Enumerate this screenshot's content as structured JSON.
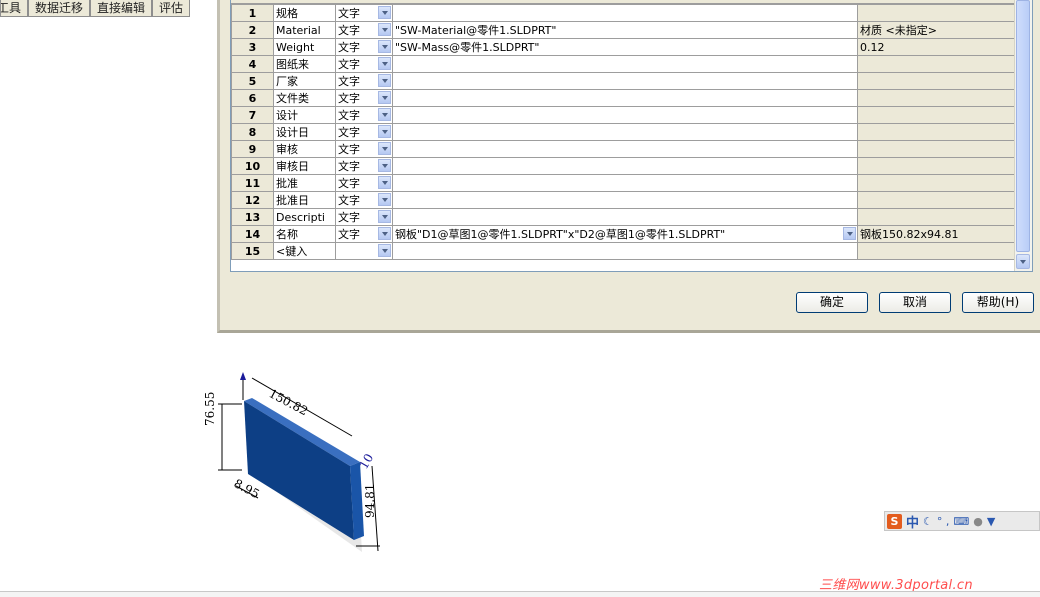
{
  "command_tabs": [
    "工具",
    "数据迁移",
    "直接编辑",
    "评估"
  ],
  "table": {
    "rows": [
      {
        "num": "1",
        "name": "规格",
        "type": "文字",
        "expr": "",
        "value": ""
      },
      {
        "num": "2",
        "name": "Material",
        "type": "文字",
        "expr": "\"SW-Material@零件1.SLDPRT\"",
        "value": "材质 <未指定>"
      },
      {
        "num": "3",
        "name": "Weight",
        "type": "文字",
        "expr": "\"SW-Mass@零件1.SLDPRT\"",
        "value": "0.12"
      },
      {
        "num": "4",
        "name": "图纸来",
        "type": "文字",
        "expr": "",
        "value": ""
      },
      {
        "num": "5",
        "name": "厂家",
        "type": "文字",
        "expr": "",
        "value": ""
      },
      {
        "num": "6",
        "name": "文件类",
        "type": "文字",
        "expr": "",
        "value": ""
      },
      {
        "num": "7",
        "name": "设计",
        "type": "文字",
        "expr": "",
        "value": ""
      },
      {
        "num": "8",
        "name": "设计日",
        "type": "文字",
        "expr": "",
        "value": ""
      },
      {
        "num": "9",
        "name": "审核",
        "type": "文字",
        "expr": "",
        "value": ""
      },
      {
        "num": "10",
        "name": "审核日",
        "type": "文字",
        "expr": "",
        "value": ""
      },
      {
        "num": "11",
        "name": "批准",
        "type": "文字",
        "expr": "",
        "value": ""
      },
      {
        "num": "12",
        "name": "批准日",
        "type": "文字",
        "expr": "",
        "value": ""
      },
      {
        "num": "13",
        "name": "Descripti",
        "type": "文字",
        "expr": "",
        "value": ""
      },
      {
        "num": "14",
        "name": "名称",
        "type": "文字",
        "expr": "钢板\"D1@草图1@零件1.SLDPRT\"x\"D2@草图1@零件1.SLDPRT\"",
        "value": "钢板150.82x94.81"
      },
      {
        "num": "15",
        "name": "<键入",
        "type": "",
        "expr": "",
        "value": ""
      }
    ]
  },
  "buttons": {
    "ok": "确定",
    "cancel": "取消",
    "help": "帮助(H)"
  },
  "model_dims": {
    "width": "150.82",
    "height": "76.55",
    "depth_left": "8.95",
    "right_height": "94.81",
    "thickness": "10"
  },
  "ime": {
    "logo": "S",
    "lang": "中",
    "symbols": "° ,"
  },
  "watermark": "三维网www.3dportal.cn",
  "colors": {
    "part_blue": "#0d3f85",
    "dialog_bg": "#ece9d8",
    "button_border": "#003c74"
  }
}
